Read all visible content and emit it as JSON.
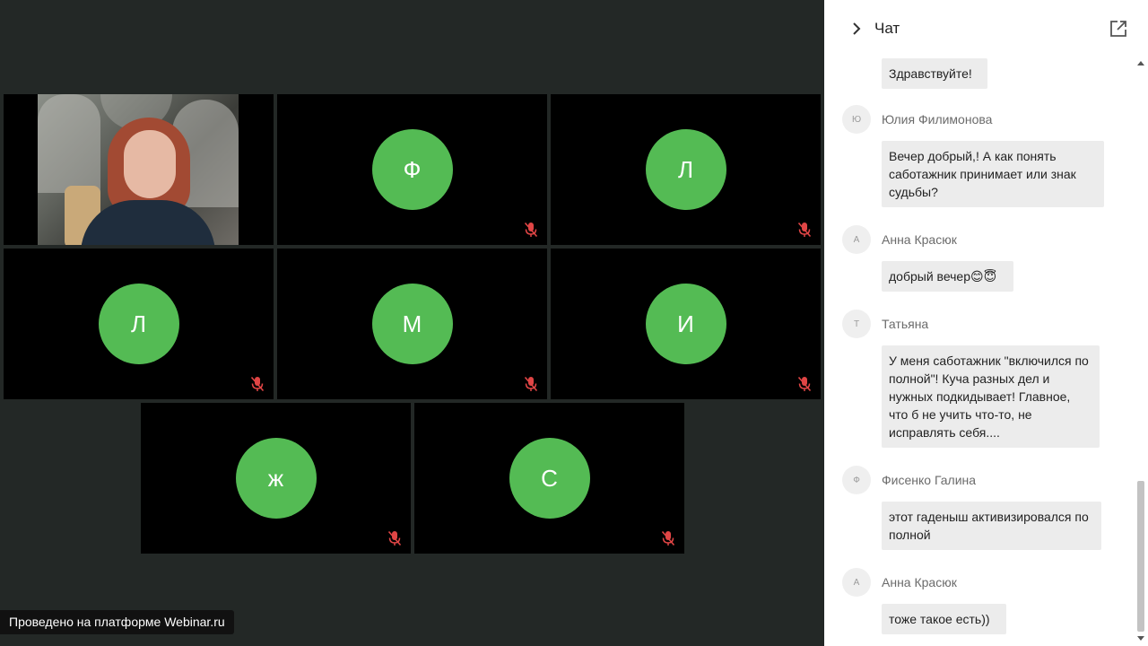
{
  "video": {
    "tiles": [
      {
        "type": "camera",
        "initial": ""
      },
      {
        "type": "avatar",
        "initial": "Ф",
        "muted": true
      },
      {
        "type": "avatar",
        "initial": "Л",
        "muted": true
      },
      {
        "type": "avatar",
        "initial": "Л",
        "muted": true
      },
      {
        "type": "avatar",
        "initial": "М",
        "muted": true
      },
      {
        "type": "avatar",
        "initial": "И",
        "muted": true
      },
      {
        "type": "avatar",
        "initial": "ж",
        "muted": true
      },
      {
        "type": "avatar",
        "initial": "С",
        "muted": true
      }
    ],
    "avatar_color": "#54bb54",
    "footer_label": "Проведено на платформе Webinar.ru"
  },
  "chat": {
    "title": "Чат",
    "messages": [
      {
        "sender": "",
        "initial": "",
        "text": "Здравствуйте!"
      },
      {
        "sender": "Юлия Филимонова",
        "initial": "Ю",
        "text": "Вечер добрый,! А как понять саботажник принимает или знак судьбы?"
      },
      {
        "sender": "Анна Красюк",
        "initial": "А",
        "text": "добрый вечер😊😇"
      },
      {
        "sender": "Татьяна",
        "initial": "Т",
        "text": "У меня саботажник \"включился по полной\"! Куча разных дел и нужных подкидывает! Главное, что б не учить что-то, не исправлять себя...."
      },
      {
        "sender": "Фисенко Галина",
        "initial": "Ф",
        "text": "этот гаденыш активизировался по полной"
      },
      {
        "sender": "Анна Красюк",
        "initial": "А",
        "text": "тоже такое есть))"
      }
    ]
  }
}
